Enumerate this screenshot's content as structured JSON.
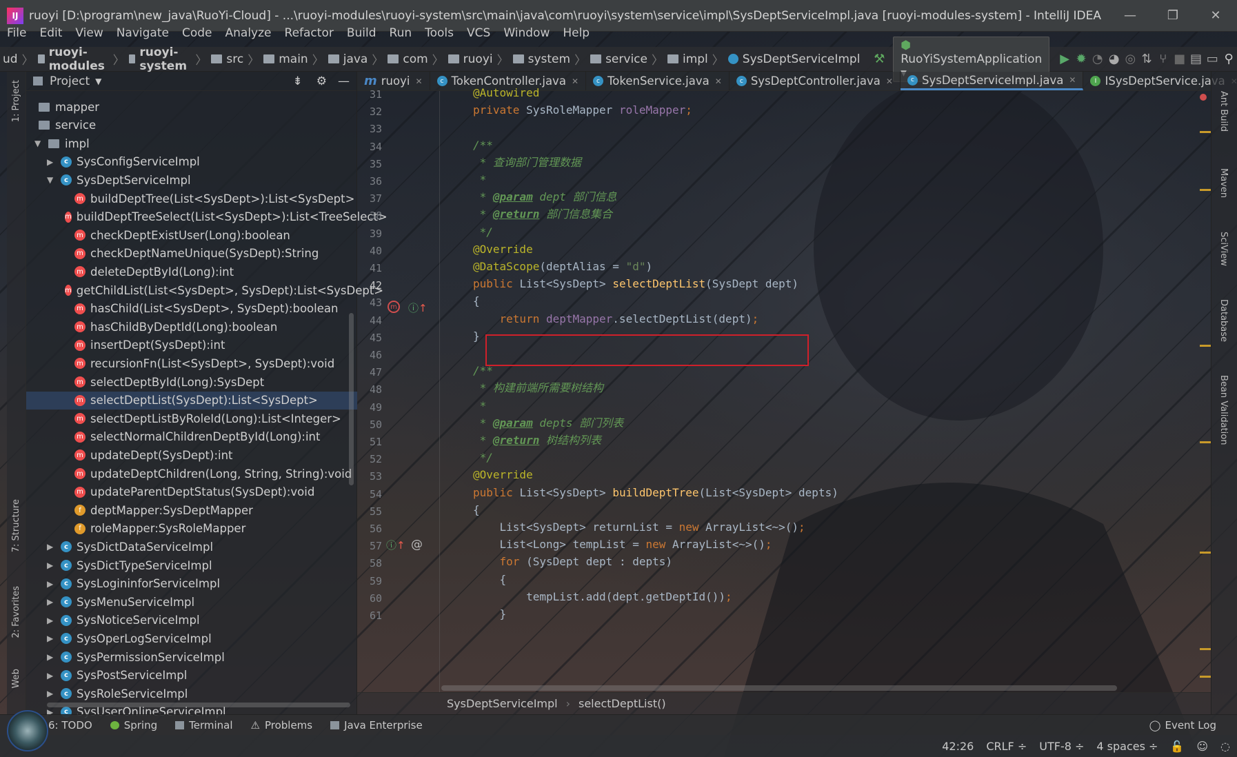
{
  "window": {
    "title": "ruoyi [D:\\program\\new_java\\RuoYi-Cloud] - ...\\ruoyi-modules\\ruoyi-system\\src\\main\\java\\com\\ruoyi\\system\\service\\impl\\SysDeptServiceImpl.java [ruoyi-modules-system] - IntelliJ IDEA",
    "minimize": "—",
    "restore": "❐",
    "close": "✕"
  },
  "menu": [
    "File",
    "Edit",
    "View",
    "Navigate",
    "Code",
    "Analyze",
    "Refactor",
    "Build",
    "Run",
    "Tools",
    "VCS",
    "Window",
    "Help"
  ],
  "nav": {
    "crumbs": [
      "ud",
      "ruoyi-modules",
      "ruoyi-system",
      "src",
      "main",
      "java",
      "com",
      "ruoyi",
      "system",
      "service",
      "impl",
      "SysDeptServiceImpl"
    ],
    "run_config": "RuoYiSystemApplication"
  },
  "left_tool_tabs": [
    "1: Project",
    "7: Structure",
    "2: Favorites",
    "Web"
  ],
  "project": {
    "title": "Project",
    "rows": [
      {
        "label": "mapper",
        "icon": "folder",
        "indent": 0,
        "arrow": ""
      },
      {
        "label": "service",
        "icon": "folder",
        "indent": 0,
        "arrow": ""
      },
      {
        "label": "impl",
        "icon": "folder",
        "indent": 0,
        "arrow": "▼"
      },
      {
        "label": "SysConfigServiceImpl",
        "icon": "class",
        "indent": 1,
        "arrow": "▶"
      },
      {
        "label": "SysDeptServiceImpl",
        "icon": "class",
        "indent": 1,
        "arrow": "▼"
      },
      {
        "label": "buildDeptTree(List<SysDept>):List<SysDept>",
        "icon": "method",
        "indent": 2,
        "arrow": ""
      },
      {
        "label": "buildDeptTreeSelect(List<SysDept>):List<TreeSelect>",
        "icon": "method",
        "indent": 2,
        "arrow": ""
      },
      {
        "label": "checkDeptExistUser(Long):boolean",
        "icon": "method",
        "indent": 2,
        "arrow": ""
      },
      {
        "label": "checkDeptNameUnique(SysDept):String",
        "icon": "method",
        "indent": 2,
        "arrow": ""
      },
      {
        "label": "deleteDeptById(Long):int",
        "icon": "method",
        "indent": 2,
        "arrow": ""
      },
      {
        "label": "getChildList(List<SysDept>, SysDept):List<SysDept>",
        "icon": "method",
        "indent": 2,
        "arrow": ""
      },
      {
        "label": "hasChild(List<SysDept>, SysDept):boolean",
        "icon": "method",
        "indent": 2,
        "arrow": ""
      },
      {
        "label": "hasChildByDeptId(Long):boolean",
        "icon": "method",
        "indent": 2,
        "arrow": ""
      },
      {
        "label": "insertDept(SysDept):int",
        "icon": "method",
        "indent": 2,
        "arrow": ""
      },
      {
        "label": "recursionFn(List<SysDept>, SysDept):void",
        "icon": "method",
        "indent": 2,
        "arrow": ""
      },
      {
        "label": "selectDeptById(Long):SysDept",
        "icon": "method",
        "indent": 2,
        "arrow": ""
      },
      {
        "label": "selectDeptList(SysDept):List<SysDept>",
        "icon": "method",
        "indent": 2,
        "arrow": "",
        "selected": true
      },
      {
        "label": "selectDeptListByRoleId(Long):List<Integer>",
        "icon": "method",
        "indent": 2,
        "arrow": ""
      },
      {
        "label": "selectNormalChildrenDeptById(Long):int",
        "icon": "method",
        "indent": 2,
        "arrow": ""
      },
      {
        "label": "updateDept(SysDept):int",
        "icon": "method",
        "indent": 2,
        "arrow": ""
      },
      {
        "label": "updateDeptChildren(Long, String, String):void",
        "icon": "method",
        "indent": 2,
        "arrow": ""
      },
      {
        "label": "updateParentDeptStatus(SysDept):void",
        "icon": "method",
        "indent": 2,
        "arrow": ""
      },
      {
        "label": "deptMapper:SysDeptMapper",
        "icon": "field",
        "indent": 2,
        "arrow": ""
      },
      {
        "label": "roleMapper:SysRoleMapper",
        "icon": "field",
        "indent": 2,
        "arrow": ""
      },
      {
        "label": "SysDictDataServiceImpl",
        "icon": "class",
        "indent": 1,
        "arrow": "▶"
      },
      {
        "label": "SysDictTypeServiceImpl",
        "icon": "class",
        "indent": 1,
        "arrow": "▶"
      },
      {
        "label": "SysLogininforServiceImpl",
        "icon": "class",
        "indent": 1,
        "arrow": "▶"
      },
      {
        "label": "SysMenuServiceImpl",
        "icon": "class",
        "indent": 1,
        "arrow": "▶"
      },
      {
        "label": "SysNoticeServiceImpl",
        "icon": "class",
        "indent": 1,
        "arrow": "▶"
      },
      {
        "label": "SysOperLogServiceImpl",
        "icon": "class",
        "indent": 1,
        "arrow": "▶"
      },
      {
        "label": "SysPermissionServiceImpl",
        "icon": "class",
        "indent": 1,
        "arrow": "▶"
      },
      {
        "label": "SysPostServiceImpl",
        "icon": "class",
        "indent": 1,
        "arrow": "▶"
      },
      {
        "label": "SysRoleServiceImpl",
        "icon": "class",
        "indent": 1,
        "arrow": "▶"
      },
      {
        "label": "SysUserOnlineServiceImpl",
        "icon": "class",
        "indent": 1,
        "arrow": "▶"
      }
    ]
  },
  "tabs": [
    {
      "label": "ruoyi",
      "icon": "m",
      "active": false
    },
    {
      "label": "TokenController.java",
      "icon": "c",
      "active": false
    },
    {
      "label": "TokenService.java",
      "icon": "c",
      "active": false
    },
    {
      "label": "SysDeptController.java",
      "icon": "c",
      "active": false
    },
    {
      "label": "SysDeptServiceImpl.java",
      "icon": "c",
      "active": true
    },
    {
      "label": "ISysDeptService.java",
      "icon": "i",
      "active": false
    }
  ],
  "tab_overflow": "⋮≡1",
  "code": [
    {
      "ln": "31",
      "html": "<span class=\"an\">@Autowired</span>"
    },
    {
      "ln": "32",
      "html": "<span class=\"kw\">private</span> <span class=\"pl\">SysRoleMapper</span> <span class=\"fd\">roleMapper</span><span class=\"kw\">;</span>"
    },
    {
      "ln": "33",
      "html": ""
    },
    {
      "ln": "34",
      "html": "<span class=\"cm\">/**</span>"
    },
    {
      "ln": "35",
      "html": "<span class=\"cm\"> * 查询部门管理数据</span>"
    },
    {
      "ln": "36",
      "html": "<span class=\"cm\"> *</span>"
    },
    {
      "ln": "37",
      "html": "<span class=\"cm\"> * </span><span class=\"tg\">@param</span><span class=\"cm\"> dept 部门信息</span>"
    },
    {
      "ln": "38",
      "html": "<span class=\"cm\"> * </span><span class=\"tg\">@return</span><span class=\"cm\"> 部门信息集合</span>"
    },
    {
      "ln": "39",
      "html": "<span class=\"cm\"> */</span>"
    },
    {
      "ln": "40",
      "html": "<span class=\"an\">@Override</span>"
    },
    {
      "ln": "41",
      "html": "<span class=\"an\">@DataScope</span><span class=\"pl\">(deptAlias = </span><span class=\"st\">\"d\"</span><span class=\"pl\">)</span>"
    },
    {
      "ln": "42",
      "html": "<span class=\"kw\">public</span> <span class=\"pl\">List&lt;SysDept&gt;</span> <span class=\"fn\">selectDeptList</span><span class=\"pl\">(SysDept dept)</span>"
    },
    {
      "ln": "43",
      "html": "<span class=\"pl\">{</span>"
    },
    {
      "ln": "44",
      "html": "    <span class=\"kw\">return</span> <span class=\"fd\">deptMapper</span><span class=\"pl\">.selectDeptList(dept)</span><span class=\"kw\">;</span>"
    },
    {
      "ln": "45",
      "html": "<span class=\"pl\">}</span>"
    },
    {
      "ln": "46",
      "html": ""
    },
    {
      "ln": "47",
      "html": "<span class=\"cm\">/**</span>"
    },
    {
      "ln": "48",
      "html": "<span class=\"cm\"> * 构建前端所需要树结构</span>"
    },
    {
      "ln": "49",
      "html": "<span class=\"cm\"> *</span>"
    },
    {
      "ln": "50",
      "html": "<span class=\"cm\"> * </span><span class=\"tg\">@param</span><span class=\"cm\"> depts 部门列表</span>"
    },
    {
      "ln": "51",
      "html": "<span class=\"cm\"> * </span><span class=\"tg\">@return</span><span class=\"cm\"> 树结构列表</span>"
    },
    {
      "ln": "52",
      "html": "<span class=\"cm\"> */</span>"
    },
    {
      "ln": "53",
      "html": "<span class=\"an\">@Override</span>"
    },
    {
      "ln": "54",
      "html": "<span class=\"kw\">public</span> <span class=\"pl\">List&lt;SysDept&gt;</span> <span class=\"fn\">buildDeptTree</span><span class=\"pl\">(List&lt;SysDept&gt; depts)</span>"
    },
    {
      "ln": "55",
      "html": "<span class=\"pl\">{</span>"
    },
    {
      "ln": "56",
      "html": "    <span class=\"pl\">List&lt;SysDept&gt; returnList = </span><span class=\"kw\">new</span> <span class=\"pl\">ArrayList&lt;~&gt;()</span><span class=\"kw\">;</span>"
    },
    {
      "ln": "57",
      "html": "    <span class=\"pl\">List&lt;Long&gt; tempList = </span><span class=\"kw\">new</span> <span class=\"pl\">ArrayList&lt;~&gt;()</span><span class=\"kw\">;</span>"
    },
    {
      "ln": "58",
      "html": "    <span class=\"kw\">for</span> <span class=\"pl\">(SysDept dept : depts)</span>"
    },
    {
      "ln": "59",
      "html": "    <span class=\"pl\">{</span>"
    },
    {
      "ln": "60",
      "html": "        <span class=\"pl\">tempList.add(dept.getDeptId())</span><span class=\"kw\">;</span>"
    },
    {
      "ln": "61",
      "html": "    <span class=\"pl\">}</span>"
    }
  ],
  "right_tool_tabs": [
    "Ant Build",
    "Maven",
    "SciView",
    "Database",
    "Bean Validation"
  ],
  "breadcrumb": [
    "SysDeptServiceImpl",
    "selectDeptList()"
  ],
  "bottom_tabs": [
    "6: TODO",
    "Spring",
    "Terminal",
    "Problems",
    "Java Enterprise"
  ],
  "event_log": "Event Log",
  "status": {
    "position": "42:26",
    "line_sep": "CRLF ÷",
    "encoding": "UTF-8 ÷",
    "indent": "4 spaces ÷"
  },
  "colors": {
    "accent": "#4a88c7",
    "highlight_box": "#d0202a",
    "selection": "#2d3e58"
  }
}
